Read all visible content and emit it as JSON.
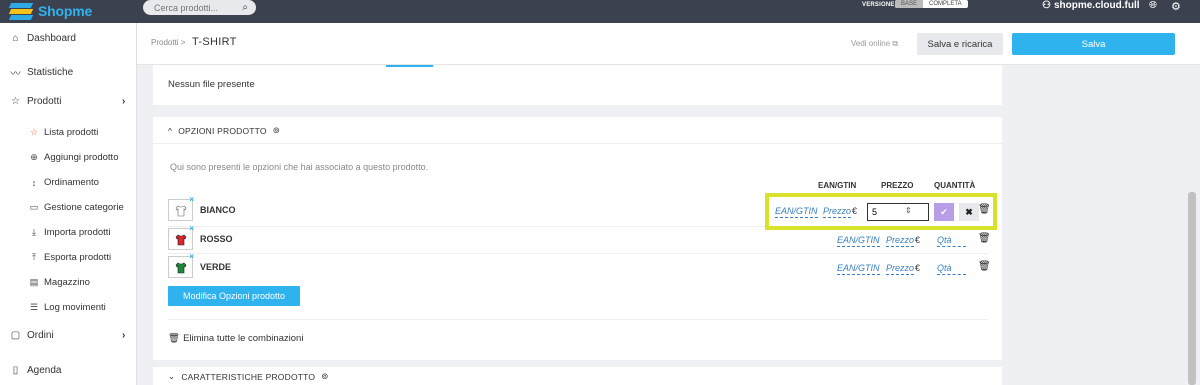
{
  "topbar": {
    "logo_text": "Shopme",
    "search_placeholder": "Cerca prodotti...",
    "version_label": "VERSIONE",
    "version_options": [
      "BASE",
      "COMPLETA"
    ],
    "account": "shopme.cloud.full"
  },
  "sidebar": {
    "items": [
      {
        "label": "Dashboard",
        "icon": "home-icon"
      },
      {
        "label": "Statistiche",
        "icon": "trend-icon"
      },
      {
        "label": "Prodotti",
        "icon": "star-icon"
      }
    ],
    "sub_items": [
      {
        "label": "Lista prodotti",
        "icon": "star-icon"
      },
      {
        "label": "Aggiungi prodotto",
        "icon": "plus-circle-icon"
      },
      {
        "label": "Ordinamento",
        "icon": "sort-icon"
      },
      {
        "label": "Gestione categorie",
        "icon": "folder-icon"
      },
      {
        "label": "Importa prodotti",
        "icon": "import-icon"
      },
      {
        "label": "Esporta prodotti",
        "icon": "export-icon"
      },
      {
        "label": "Magazzino",
        "icon": "warehouse-icon"
      },
      {
        "label": "Log movimenti",
        "icon": "list-icon"
      }
    ],
    "bottom_items": [
      {
        "label": "Ordini",
        "icon": "box-icon"
      },
      {
        "label": "Agenda",
        "icon": "book-icon"
      }
    ]
  },
  "header": {
    "breadcrumb": "Prodotti",
    "title": "T-SHIRT",
    "vedi_online": "Vedi online",
    "btn_ricarica": "Salva e ricarica",
    "btn_salva": "Salva"
  },
  "files": {
    "empty_text": "Nessun file presente"
  },
  "opzioni": {
    "title": "OPZIONI PRODOTTO",
    "intro": "Qui sono presenti le opzioni che hai associato a questo prodotto.",
    "col_ean": "EAN/GTIN",
    "col_prezzo": "PREZZO",
    "col_quantita": "QUANTITÀ",
    "rows": [
      {
        "name": "BIANCO",
        "color": "#ffffff",
        "ean": "EAN/GTIN",
        "prezzo": "Prezzo",
        "euro": "€",
        "editing_value": "5"
      },
      {
        "name": "ROSSO",
        "color": "#d9252b",
        "ean": "EAN/GTIN",
        "prezzo": "Prezzo",
        "euro": "€",
        "qty": "Qtà"
      },
      {
        "name": "VERDE",
        "color": "#1e8a3a",
        "ean": "EAN/GTIN",
        "prezzo": "Prezzo",
        "euro": "€",
        "qty": "Qtà"
      }
    ],
    "btn_modifica": "Modifica Opzioni prodotto",
    "elimina": "Elimina tutte le combinazioni"
  },
  "caratteristiche": {
    "title": "CARATTERISTICHE PRODOTTO"
  },
  "colors": {
    "accent": "#2fb3ee",
    "highlight": "#d8e22b",
    "confirm": "#b89ee6"
  }
}
